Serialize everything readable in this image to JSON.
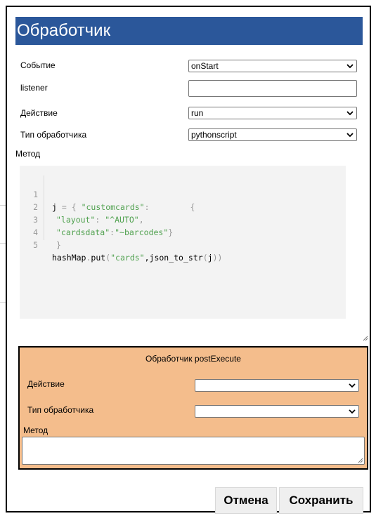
{
  "dialog": {
    "title": "Обработчик"
  },
  "form": {
    "event": {
      "label": "Событие",
      "value": "onStart"
    },
    "listener": {
      "label": "listener",
      "value": ""
    },
    "action": {
      "label": "Действие",
      "value": "run"
    },
    "handler_type": {
      "label": "Тип обработчика",
      "value": "pythonscript"
    },
    "method": {
      "label": "Метод"
    }
  },
  "code_editor": {
    "lines": [
      {
        "number": "1"
      },
      {
        "number": "2"
      },
      {
        "number": "3"
      },
      {
        "number": "4"
      },
      {
        "number": "5"
      }
    ],
    "tokens": {
      "l1_var": "j",
      "l1_eq": " = ",
      "l1_brace": "{ ",
      "l1_key": "\"customcards\"",
      "l1_colon": ":",
      "l1_brace2": "{",
      "l2_key": "\"layout\"",
      "l2_colon": ": ",
      "l2_val": "\"^AUTO\"",
      "l2_comma": ",",
      "l3_key": "\"cardsdata\"",
      "l3_colon": ":",
      "l3_val": "\"~barcodes\"",
      "l3_brace": "}",
      "l4_brace": "}",
      "l5_a": "hashMap",
      "l5_dot": ".",
      "l5_b": "put",
      "l5_paren": "(",
      "l5_str": "\"cards\"",
      "l5_c": ",json_to_str",
      "l5_paren2": "(",
      "l5_d": "j",
      "l5_paren3": "))"
    }
  },
  "post_execute": {
    "title": "Обработчик postExecute",
    "action": {
      "label": "Действие",
      "value": ""
    },
    "handler_type": {
      "label": "Тип обработчика",
      "value": ""
    },
    "method": {
      "label": "Метод",
      "value": ""
    }
  },
  "buttons": {
    "cancel": "Отмена",
    "save": "Сохранить"
  },
  "colors": {
    "title_bar": "#2b579a",
    "post_panel": "#f4bd8c",
    "code_bg": "#f3f3f3",
    "string": "#50a14f"
  }
}
